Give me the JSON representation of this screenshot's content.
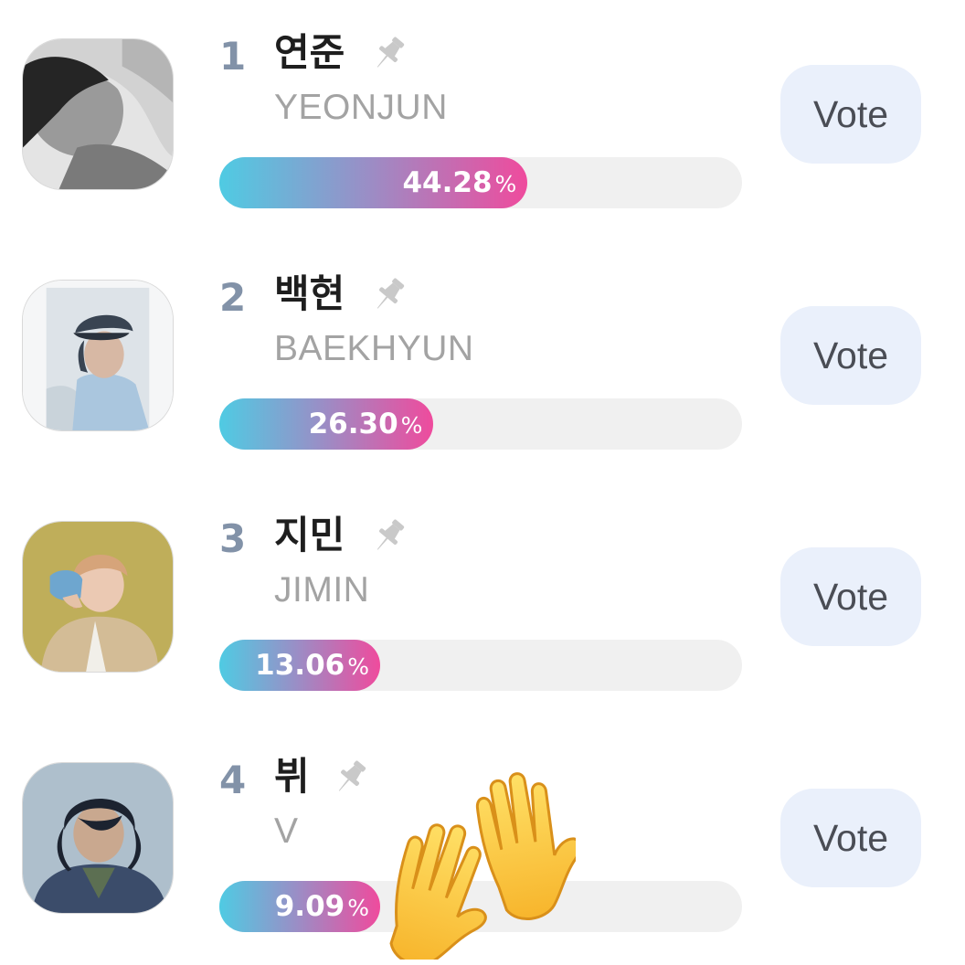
{
  "candidates": [
    {
      "rank": "1",
      "name_ko": "연준",
      "name_en": "YEONJUN",
      "percent_text": "44.28",
      "percent_symbol": "%",
      "share": 44.28,
      "vote_label": "Vote",
      "pin_icon": "pin-icon",
      "photo_colors": {
        "bg": "#d2d2d2",
        "hair": "#252525",
        "skin": "#9a9a9a",
        "cloth": "#e4e4e4"
      }
    },
    {
      "rank": "2",
      "name_ko": "백현",
      "name_en": "BAEKHYUN",
      "percent_text": "26.30",
      "percent_symbol": "%",
      "share": 26.3,
      "vote_label": "Vote",
      "pin_icon": "pin-icon",
      "photo_colors": {
        "bg": "#dde3e8",
        "hair": "#394452",
        "skin": "#d7b8a4",
        "cloth": "#aac6de"
      }
    },
    {
      "rank": "3",
      "name_ko": "지민",
      "name_en": "JIMIN",
      "percent_text": "13.06",
      "percent_symbol": "%",
      "share": 13.06,
      "vote_label": "Vote",
      "pin_icon": "pin-icon",
      "photo_colors": {
        "bg": "#bfae5a",
        "hair": "#d6a47a",
        "skin": "#ebc9b3",
        "cloth": "#d3bc96"
      }
    },
    {
      "rank": "4",
      "name_ko": "뷔",
      "name_en": "V",
      "percent_text": "9.09",
      "percent_symbol": "%",
      "share": 9.09,
      "vote_label": "Vote",
      "pin_icon": "pin-icon",
      "photo_colors": {
        "bg": "#aebfcc",
        "hair": "#1c2330",
        "skin": "#c9a88f",
        "cloth": "#3b4c6a"
      }
    }
  ],
  "overlay": {
    "icon": "raised-hands-emoji-icon"
  },
  "colors": {
    "rank": "#8292a8",
    "name_ko": "#1e1e1e",
    "name_en": "#a3a3a3",
    "bar_start": "#4fcbe3",
    "bar_end": "#ef4b9d",
    "track": "#f0f0f0",
    "vote_bg": "#eaf0fb",
    "pin": "#c9c9c9"
  }
}
